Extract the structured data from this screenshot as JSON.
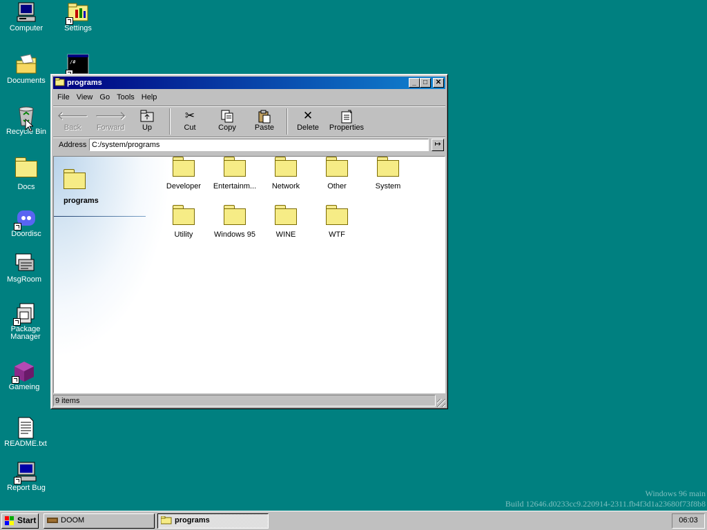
{
  "desktop": {
    "icons": [
      {
        "label": "Computer",
        "icon": "computer-icon"
      },
      {
        "label": "Settings",
        "icon": "settings-icon"
      },
      {
        "label": "Documents",
        "icon": "documents-icon"
      },
      {
        "label": "Recycle Bin",
        "icon": "recycle-bin-icon"
      },
      {
        "label": "Docs",
        "icon": "folder-icon"
      },
      {
        "label": "Doordisc",
        "icon": "doordisc-icon"
      },
      {
        "label": "MsgRoom",
        "icon": "msgroom-icon"
      },
      {
        "label": "Package Manager",
        "icon": "package-manager-icon"
      },
      {
        "label": "Gameing",
        "icon": "gameing-icon"
      },
      {
        "label": "README.txt",
        "icon": "text-file-icon"
      },
      {
        "label": "Report Bug",
        "icon": "report-bug-icon"
      }
    ],
    "watermark": {
      "line1": "Windows 96 main",
      "line2": "Build 12646.d0233cc9.220914-2311.fb4f3d1a23680f73f8b8"
    }
  },
  "window": {
    "title": "programs",
    "controls": {
      "minimize": "_",
      "maximize": "□",
      "close": "✕"
    },
    "menu": [
      "File",
      "View",
      "Go",
      "Tools",
      "Help"
    ],
    "toolbar": {
      "back": "Back",
      "forward": "Forward",
      "up": "Up",
      "cut": "Cut",
      "copy": "Copy",
      "paste": "Paste",
      "delete": "Delete",
      "properties": "Properties"
    },
    "address": {
      "label": "Address",
      "value": "C:/system/programs",
      "go": "↦"
    },
    "left_pane": {
      "folder_name": "programs"
    },
    "items": [
      {
        "label": "Developer"
      },
      {
        "label": "Entertainm..."
      },
      {
        "label": "Network"
      },
      {
        "label": "Other"
      },
      {
        "label": "System"
      },
      {
        "label": "Utility"
      },
      {
        "label": "Windows 95"
      },
      {
        "label": "WINE"
      },
      {
        "label": "WTF"
      }
    ],
    "status": "9 items"
  },
  "taskbar": {
    "start_label": "Start",
    "tasks": [
      {
        "label": "DOOM",
        "active": false
      },
      {
        "label": "programs",
        "active": true
      }
    ],
    "clock": "06:03"
  },
  "colors": {
    "desktop": "#008080",
    "titlebar_start": "#000080",
    "titlebar_end": "#1084d0",
    "folder": "#f6ec86"
  }
}
